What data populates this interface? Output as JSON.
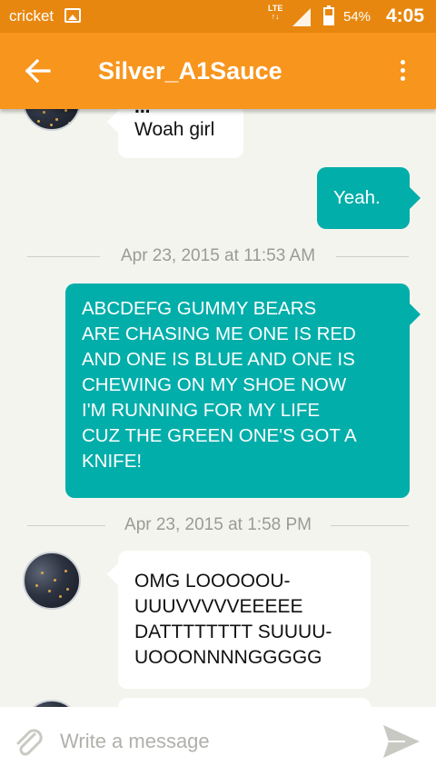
{
  "status_bar": {
    "carrier": "cricket",
    "network": "LTE",
    "battery_percent": "54%",
    "battery_level": 0.54,
    "time": "4:05",
    "icons": [
      "image-icon",
      "signal-icon",
      "battery-icon"
    ]
  },
  "app_bar": {
    "title": "Silver_A1Sauce",
    "back_icon": "arrow-left-icon",
    "menu_icon": "more-vert-icon"
  },
  "messages": [
    {
      "direction": "incoming",
      "text_partial_top": "...",
      "text": "Woah girl"
    },
    {
      "direction": "outgoing",
      "text": "Yeah."
    },
    {
      "type": "timestamp",
      "text": "Apr 23, 2015 at 11:53 AM"
    },
    {
      "direction": "outgoing",
      "lines": [
        "ABCDEFG GUMMY BEARS",
        "ARE CHASING ME ONE IS RED",
        "AND ONE IS BLUE AND ONE IS",
        "CHEWING ON MY SHOE NOW",
        "I'M RUNNING FOR MY LIFE",
        "CUZ THE GREEN ONE'S GOT A",
        "KNIFE!"
      ]
    },
    {
      "type": "timestamp",
      "text": "Apr 23, 2015 at 1:58 PM"
    },
    {
      "direction": "incoming",
      "lines": [
        "OMG LOOOOOU-",
        "UUUVVVVVEEEEE",
        "DATTTTTTTT SUUUU-",
        "UOOONNNNGGGGG"
      ]
    }
  ],
  "composer": {
    "placeholder": "Write a message",
    "attach_icon": "paperclip-icon",
    "send_icon": "send-icon"
  },
  "colors": {
    "status_bar": "#e8870f",
    "app_bar": "#f7951d",
    "outgoing_bubble": "#02aeaa",
    "incoming_bubble": "#ffffff",
    "background": "#f4f4ee"
  }
}
